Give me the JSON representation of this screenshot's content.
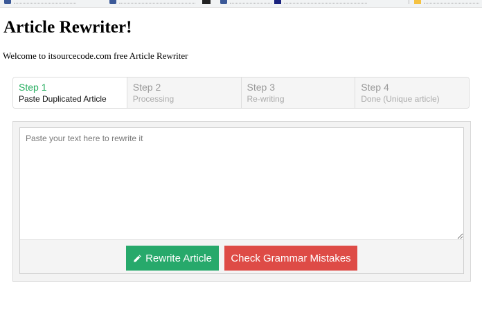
{
  "page": {
    "title": "Article Rewriter!",
    "welcome": "Welcome to itsourcecode.com free Article Rewriter"
  },
  "steps": [
    {
      "title": "Step 1",
      "desc": "Paste Duplicated Article",
      "active": true
    },
    {
      "title": "Step 2",
      "desc": "Processing",
      "active": false
    },
    {
      "title": "Step 3",
      "desc": "Re-writing",
      "active": false
    },
    {
      "title": "Step 4",
      "desc": "Done (Unique article)",
      "active": false
    }
  ],
  "editor": {
    "placeholder": "Paste your text here to rewrite it",
    "value": ""
  },
  "buttons": {
    "rewrite_label": "Rewrite Article",
    "rewrite_icon": "pencil-icon",
    "grammar_label": "Check Grammar Mistakes"
  },
  "colors": {
    "step_active": "#27ae60",
    "rewrite_button": "#27a96b",
    "grammar_button": "#de4b46"
  }
}
